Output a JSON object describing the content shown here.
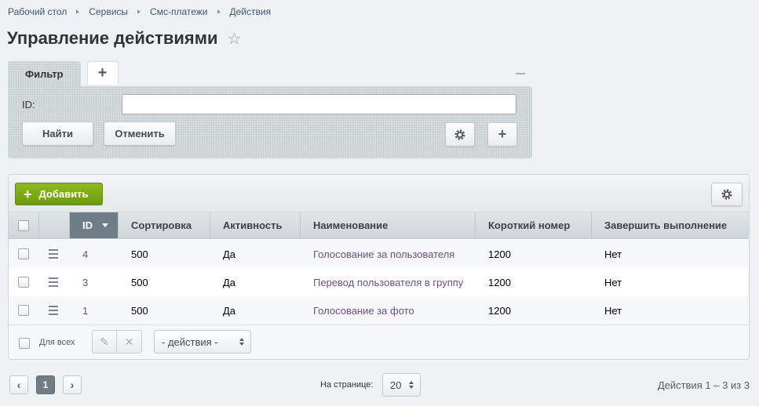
{
  "breadcrumb": [
    "Рабочий стол",
    "Сервисы",
    "Смс-платежи",
    "Действия"
  ],
  "page_title": "Управление действиями",
  "filter": {
    "tab_label": "Фильтр",
    "add_tab": "+",
    "field_label": "ID:",
    "field_value": "",
    "find_label": "Найти",
    "cancel_label": "Отменить"
  },
  "grid": {
    "add_label": "Добавить",
    "columns": [
      "ID",
      "Сортировка",
      "Активность",
      "Наименование",
      "Короткий номер",
      "Завершить выполнение"
    ],
    "sorted_column": "ID",
    "rows": [
      {
        "id": "4",
        "sort": "500",
        "active": "Да",
        "name": "Голосование за пользователя",
        "short_number": "1200",
        "finish": "Нет"
      },
      {
        "id": "3",
        "sort": "500",
        "active": "Да",
        "name": "Перевод пользователя в группу",
        "short_number": "1200",
        "finish": "Нет"
      },
      {
        "id": "1",
        "sort": "500",
        "active": "Да",
        "name": "Голосование за фото",
        "short_number": "1200",
        "finish": "Нет"
      }
    ],
    "for_all_label": "Для всех",
    "actions_select": "- действия -"
  },
  "pagination": {
    "prev": "‹",
    "current_page": "1",
    "next": "›",
    "per_page_label": "На странице:",
    "per_page_value": "20",
    "summary": "Действия 1 – 3 из 3"
  },
  "icons": {
    "star": "star-outline",
    "gear": "gear",
    "plus": "plus",
    "drag": "drag-handle",
    "pencil": "pencil",
    "close": "cross"
  },
  "colors": {
    "add_button": "#7cab12",
    "sorted_header": "#6f7d87",
    "link": "#6b4f86"
  }
}
